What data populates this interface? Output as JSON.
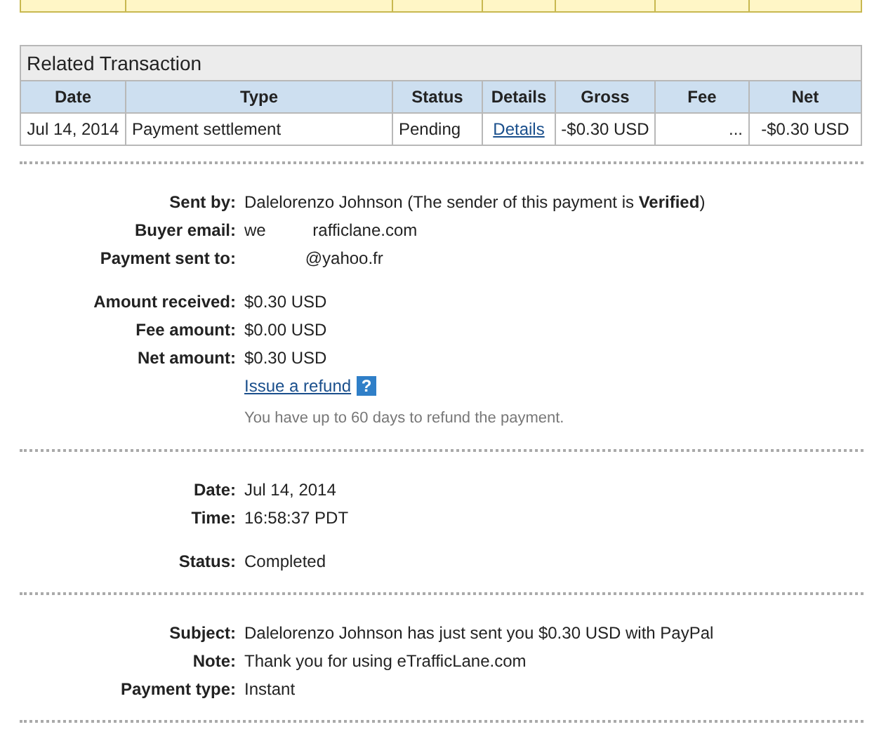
{
  "related_transaction": {
    "title": "Related Transaction",
    "columns": [
      "Date",
      "Type",
      "Status",
      "Details",
      "Gross",
      "Fee",
      "Net"
    ],
    "rows": [
      {
        "cells": [
          {
            "text": "Jul 14, 2014",
            "kind": "center"
          },
          {
            "text": "Payment settlement",
            "kind": "left"
          },
          {
            "text": "Pending",
            "kind": "left"
          },
          {
            "text": "Details",
            "kind": "link"
          },
          {
            "text": "-$0.30 USD",
            "kind": "center"
          },
          {
            "text": "...",
            "kind": "right"
          },
          {
            "text": "-$0.30 USD",
            "kind": "center"
          }
        ]
      }
    ]
  },
  "sections": [
    {
      "rows": [
        {
          "kind": "field",
          "label": "Sent by:",
          "value": "Dalelorenzo Johnson (The sender of this payment is **Verified**)"
        },
        {
          "kind": "field",
          "label": "Buyer email:",
          "value": "we          rafficlane.com"
        },
        {
          "kind": "field",
          "label": "Payment sent to:",
          "value": "             @yahoo.fr"
        },
        {
          "kind": "spacer"
        },
        {
          "kind": "field",
          "label": "Amount received:",
          "value": "$0.30 USD"
        },
        {
          "kind": "field",
          "label": "Fee amount:",
          "value": "$0.00 USD"
        },
        {
          "kind": "field",
          "label": "Net amount:",
          "value": "$0.30 USD"
        },
        {
          "kind": "link",
          "value": "Issue a refund",
          "help": "?"
        },
        {
          "kind": "note",
          "value": "You have up to 60 days to refund the payment."
        }
      ]
    },
    {
      "rows": [
        {
          "kind": "field",
          "label": "Date:",
          "value": "Jul 14, 2014"
        },
        {
          "kind": "field",
          "label": "Time:",
          "value": "16:58:37 PDT"
        },
        {
          "kind": "spacer"
        },
        {
          "kind": "field",
          "label": "Status:",
          "value": "Completed"
        }
      ]
    },
    {
      "rows": [
        {
          "kind": "field",
          "label": "Subject:",
          "value": "Dalelorenzo Johnson has just sent you $0.30 USD with PayPal"
        },
        {
          "kind": "field",
          "label": "Note:",
          "value": "Thank you for using eTrafficLane.com"
        },
        {
          "kind": "field",
          "label": "Payment type:",
          "value": "Instant"
        }
      ]
    }
  ]
}
